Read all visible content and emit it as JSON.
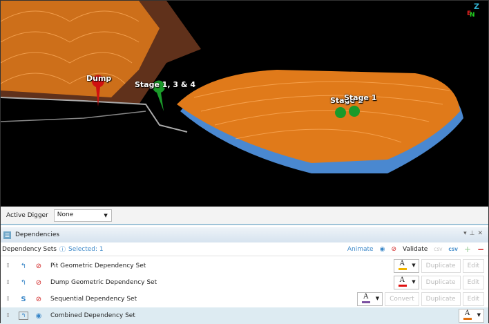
{
  "viewport": {
    "labels": {
      "dump": "Dump",
      "stage134": "Stage 1, 3 & 4",
      "stage1": "Stage 1",
      "stage2": "Stage 1"
    },
    "axes": {
      "z": "Z",
      "e": "E",
      "n": "N"
    }
  },
  "active_digger": {
    "label": "Active Digger",
    "value": "None"
  },
  "panel": {
    "title": "Dependencies",
    "section": "Dependency Sets",
    "selected": "Selected: 1"
  },
  "toolbar": {
    "animate": "Animate",
    "validate": "Validate",
    "import_csv": "CSV",
    "export_csv": "CSV",
    "add": "+",
    "remove": "−"
  },
  "rows": [
    {
      "name": "Pit Geometric Dependency Set",
      "color": "#f0b400",
      "duplicate": "Duplicate",
      "edit": "Edit"
    },
    {
      "name": "Dump Geometric Dependency Set",
      "color": "#e01010",
      "duplicate": "Duplicate",
      "edit": "Edit"
    },
    {
      "name": "Sequential Dependency Set",
      "color": "#7a4fa0",
      "convert": "Convert",
      "duplicate": "Duplicate",
      "edit": "Edit"
    },
    {
      "name": "Combined Dependency Set",
      "color": "#e07010"
    }
  ]
}
